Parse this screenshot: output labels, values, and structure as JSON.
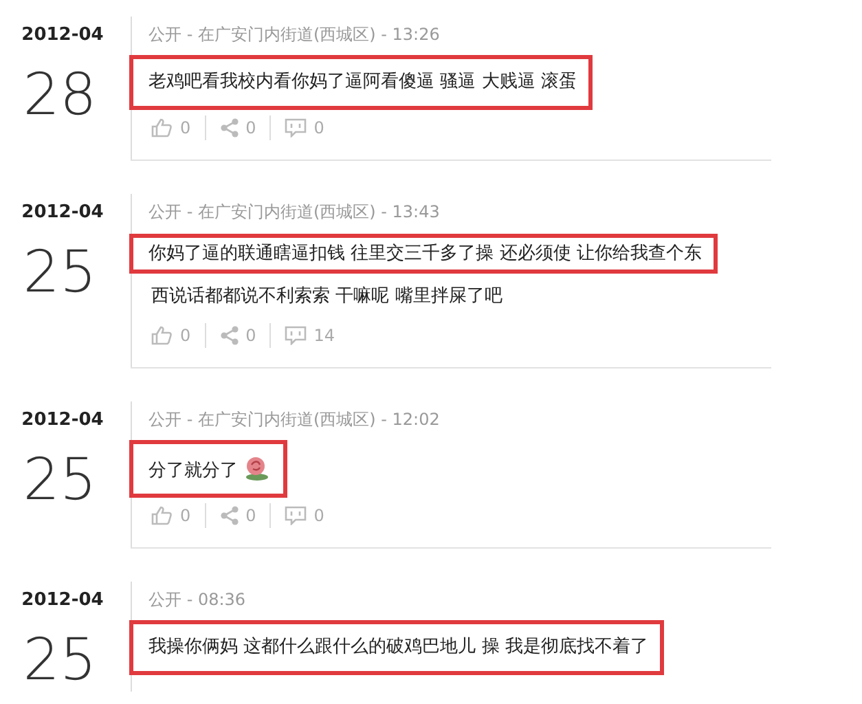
{
  "entries": [
    {
      "month": "2012-04",
      "day": "28",
      "meta": "公开 - 在广安门内街道(西城区) - 13:26",
      "lines": [
        {
          "text": "老鸡吧看我校内看你妈了逼阿看傻逼 骚逼 大贱逼 滚蛋",
          "highlighted": true
        }
      ],
      "emoji": false,
      "likes": "0",
      "shares": "0",
      "comments": "0"
    },
    {
      "month": "2012-04",
      "day": "25",
      "meta": "公开 - 在广安门内街道(西城区) - 13:43",
      "lines": [
        {
          "text": "你妈了逼的联通瞎逼扣钱 往里交三千多了操 还必须使 让你给我查个东",
          "highlighted": true
        },
        {
          "text": "西说话都都说不利索索 干嘛呢 嘴里拌屎了吧",
          "highlighted": false
        }
      ],
      "emoji": false,
      "likes": "0",
      "shares": "0",
      "comments": "14"
    },
    {
      "month": "2012-04",
      "day": "25",
      "meta": "公开 - 在广安门内街道(西城区) - 12:02",
      "lines": [
        {
          "text": "分了就分了",
          "highlighted": true
        }
      ],
      "emoji": true,
      "likes": "0",
      "shares": "0",
      "comments": "0"
    },
    {
      "month": "2012-04",
      "day": "25",
      "meta": "公开 - 08:36",
      "lines": [
        {
          "text": "我操你俩妈 这都什么跟什么的破鸡巴地儿 操 我是彻底找不着了",
          "highlighted": true
        }
      ],
      "emoji": false
    }
  ]
}
